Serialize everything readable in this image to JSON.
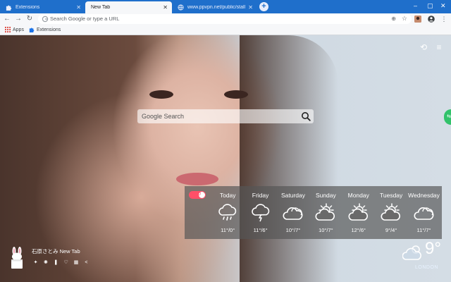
{
  "tabs": [
    {
      "title": "Extensions",
      "favicon": "puzzle-icon",
      "active": false
    },
    {
      "title": "New Tab",
      "favicon": "none",
      "active": true
    },
    {
      "title": "www.ppvpn.net/public/stall/C",
      "favicon": "globe-icon",
      "active": false
    }
  ],
  "toolbar": {
    "omnibox_placeholder": "Search Google or type a URL"
  },
  "bookmarks": [
    {
      "label": "Apps",
      "icon": "apps-grid-icon"
    },
    {
      "label": "Extensions",
      "icon": "puzzle-icon"
    }
  ],
  "page": {
    "search_placeholder": "Google Search",
    "weather_toggle_value": "0",
    "forecast": [
      {
        "day": "Today",
        "temp": "11°/0°",
        "icon": "rain-cloud-icon"
      },
      {
        "day": "Friday",
        "temp": "11°/6°",
        "icon": "thunder-cloud-icon"
      },
      {
        "day": "Saturday",
        "temp": "10°/7°",
        "icon": "cloud-icon"
      },
      {
        "day": "Sunday",
        "temp": "10°/7°",
        "icon": "partly-sunny-icon"
      },
      {
        "day": "Monday",
        "temp": "12°/6°",
        "icon": "partly-sunny-icon"
      },
      {
        "day": "Tuesday",
        "temp": "9°/4°",
        "icon": "partly-sunny-icon"
      },
      {
        "day": "Wednesday",
        "temp": "11°/7°",
        "icon": "cloud-icon"
      }
    ],
    "current": {
      "temp": "9°",
      "location": "LONDON",
      "icon": "partly-cloudy-icon"
    },
    "brand_title": "石原さとみ New Tab"
  },
  "colors": {
    "tab_strip": "#1f6fcb",
    "toolbar": "#f6f7f9",
    "toggle": "#ff4f68",
    "side_tab": "#31c26a"
  }
}
